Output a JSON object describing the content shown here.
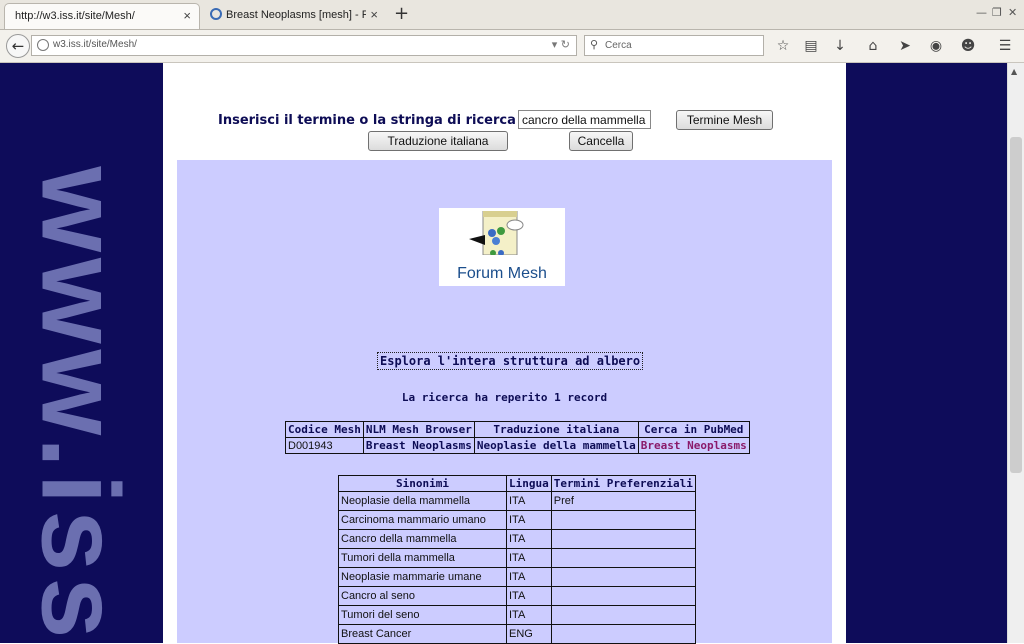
{
  "browser": {
    "tabs": [
      {
        "label": "http://w3.iss.it/site/Mesh/",
        "active": true
      },
      {
        "label": "Breast Neoplasms [mesh] - Pu...",
        "active": false
      }
    ],
    "url": "w3.iss.it/site/Mesh/",
    "search_placeholder": "Cerca",
    "new_tab": "+",
    "close_glyph": "×"
  },
  "side_watermark": "www.iss.",
  "search": {
    "label": "Inserisci il termine o la stringa di ricerca",
    "value": "cancro della mammella",
    "mesh_button": "Termine Mesh",
    "translate_button": "Traduzione italiana",
    "cancel_button": "Cancella"
  },
  "forum": {
    "label": "Forum Mesh"
  },
  "tree_link": "Esplora l'intera struttura ad albero",
  "result_count": "La ricerca ha reperito 1 record",
  "records": {
    "headers": [
      "Codice Mesh",
      "NLM Mesh Browser",
      "Traduzione italiana",
      "Cerca in PubMed"
    ],
    "rows": [
      {
        "code": "D001943",
        "nlm": "Breast Neoplasms",
        "translation": "Neoplasie della mammella",
        "pubmed": "Breast Neoplasms"
      }
    ]
  },
  "synonyms": {
    "headers": [
      "Sinonimi",
      "Lingua",
      "Termini Preferenziali"
    ],
    "rows": [
      {
        "term": "Neoplasie della mammella",
        "lang": "ITA",
        "pref": "Pref"
      },
      {
        "term": "Carcinoma mammario umano",
        "lang": "ITA",
        "pref": ""
      },
      {
        "term": "Cancro della mammella",
        "lang": "ITA",
        "pref": ""
      },
      {
        "term": "Tumori della mammella",
        "lang": "ITA",
        "pref": ""
      },
      {
        "term": "Neoplasie mammarie umane",
        "lang": "ITA",
        "pref": ""
      },
      {
        "term": "Cancro al seno",
        "lang": "ITA",
        "pref": ""
      },
      {
        "term": "Tumori del seno",
        "lang": "ITA",
        "pref": ""
      },
      {
        "term": "Breast Cancer",
        "lang": "ENG",
        "pref": ""
      }
    ]
  }
}
